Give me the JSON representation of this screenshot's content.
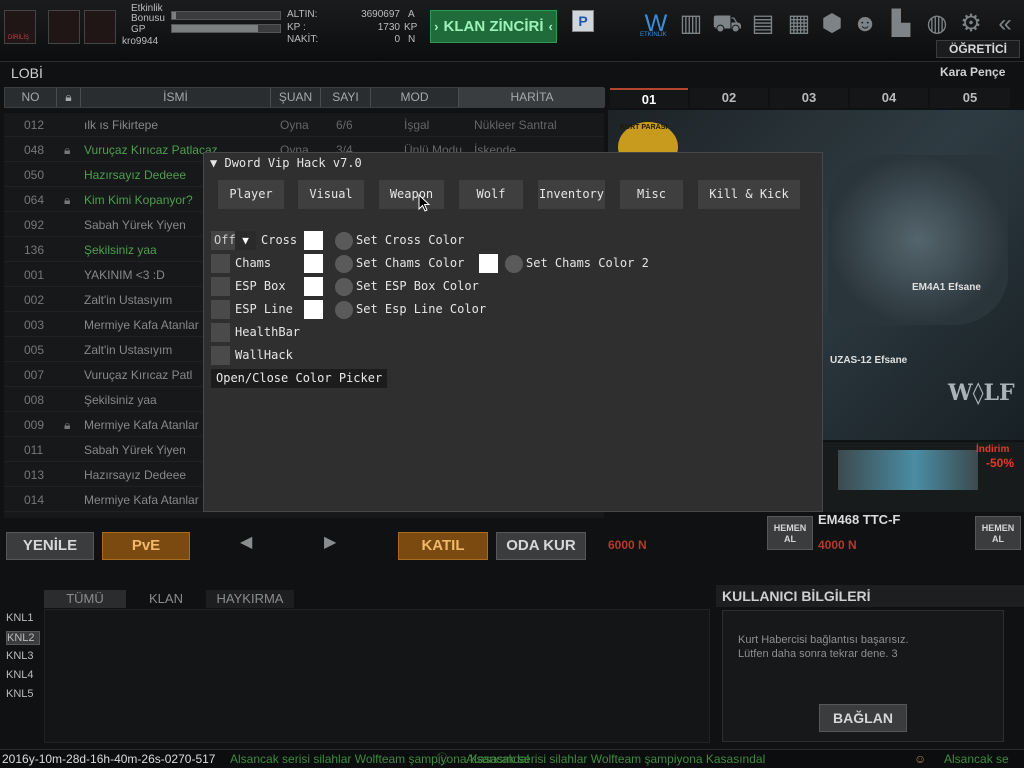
{
  "topbar": {
    "etkinlik": "Etkinlik",
    "bonusu": "Bonusu",
    "gp": "GP",
    "username": "kro9944",
    "altin_label": "ALTIN:",
    "altin_value": "3690697",
    "altin_unit": "A",
    "kp_label": "KP :",
    "kp_value": "1730",
    "kp_unit": "KP",
    "nakit_label": "NAKİT:",
    "nakit_value": "0",
    "nakit_unit": "N",
    "clan_button": "KLAN ZİNCİRİ",
    "ogretici": "ÖĞRETİCİ",
    "etkinlik_icon_label": "ETKİNLİK"
  },
  "lobby": {
    "title": "LOBİ",
    "right_label": "Kara Pençe",
    "headers": [
      "NO",
      "İSMİ",
      "ŞUAN",
      "SAYI",
      "MOD",
      "HARİTA"
    ],
    "rooms": [
      {
        "no": "012",
        "name": "ılk ıs Fikirtepe",
        "state": "Oyna",
        "count": "6/6",
        "mode": "İşgal",
        "map": "Nükleer Santral",
        "locked": false,
        "green": false
      },
      {
        "no": "048",
        "name": "Vuruçaz Kırıcaz Patlacaz",
        "state": "Oyna",
        "count": "3/4",
        "mode": "Ünlü Modu",
        "map": "İskende",
        "locked": true,
        "green": true
      },
      {
        "no": "050",
        "name": "Hazırsayız Dedeee",
        "state": "",
        "count": "",
        "mode": "",
        "map": "",
        "locked": false,
        "green": true
      },
      {
        "no": "064",
        "name": "Kim Kimi Kopanyor?",
        "state": "",
        "count": "",
        "mode": "",
        "map": "",
        "locked": true,
        "green": true
      },
      {
        "no": "092",
        "name": "Sabah Yürek Yiyen",
        "state": "",
        "count": "",
        "mode": "",
        "map": "",
        "locked": false,
        "green": false
      },
      {
        "no": "136",
        "name": "Şekilsiniz yaa",
        "state": "",
        "count": "",
        "mode": "",
        "map": "",
        "locked": false,
        "green": true
      },
      {
        "no": "001",
        "name": "YAKINIM <3 :D",
        "state": "",
        "count": "",
        "mode": "",
        "map": "",
        "locked": false,
        "green": false
      },
      {
        "no": "002",
        "name": "Zalt'in Ustasıyım",
        "state": "",
        "count": "",
        "mode": "",
        "map": "",
        "locked": false,
        "green": false
      },
      {
        "no": "003",
        "name": "Mermiye Kafa Atanlar",
        "state": "",
        "count": "",
        "mode": "",
        "map": "",
        "locked": false,
        "green": false
      },
      {
        "no": "005",
        "name": "Zalt'in Ustasıyım",
        "state": "",
        "count": "",
        "mode": "",
        "map": "",
        "locked": false,
        "green": false
      },
      {
        "no": "007",
        "name": "Vuruçaz Kırıcaz Patl",
        "state": "",
        "count": "",
        "mode": "",
        "map": "",
        "locked": false,
        "green": false
      },
      {
        "no": "008",
        "name": "Şekilsiniz yaa",
        "state": "",
        "count": "",
        "mode": "",
        "map": "",
        "locked": false,
        "green": false
      },
      {
        "no": "009",
        "name": "Mermiye Kafa Atanlar",
        "state": "",
        "count": "",
        "mode": "",
        "map": "",
        "locked": true,
        "green": false
      },
      {
        "no": "011",
        "name": "Sabah Yürek Yiyen",
        "state": "",
        "count": "",
        "mode": "",
        "map": "",
        "locked": false,
        "green": false
      },
      {
        "no": "013",
        "name": "Hazırsayız Dedeee",
        "state": "",
        "count": "",
        "mode": "",
        "map": "",
        "locked": false,
        "green": false
      },
      {
        "no": "014",
        "name": "Mermiye Kafa Atanlar",
        "state": "",
        "count": "",
        "mode": "",
        "map": "",
        "locked": false,
        "green": false
      }
    ],
    "yenile": "YENİLE",
    "pve": "PvE",
    "katil": "KATIL",
    "oda_kur": "ODA KUR"
  },
  "right_panel": {
    "slots": [
      "01",
      "02",
      "03",
      "04",
      "05"
    ],
    "kurt_parasi": "KURT PARASI",
    "weapon1": "EM4A1 Efsane",
    "weapon2": "UZAS-12 Efsane",
    "indirim": "İndirim",
    "discount": "-50%",
    "item_name": "EM468 TTC-F",
    "price_old": "6000 N",
    "price_new": "4000 N",
    "buy_label_1": "HEMEN",
    "buy_label_2": "AL"
  },
  "chat": {
    "tabs": [
      "TÜMÜ",
      "KLAN",
      "HAYKIRMA"
    ],
    "channels": [
      "KNL1",
      "KNL2",
      "KNL3",
      "KNL4",
      "KNL5"
    ]
  },
  "user_info": {
    "title": "KULLANICI BİLGİLERİ",
    "message_line1": "Kurt Habercisi bağlantısı başarısız.",
    "message_line2": "Lütfen daha sonra tekrar dene. 3",
    "connect": "BAĞLAN"
  },
  "status": {
    "timestamp": "2016y-10m-28d-16h-40m-26s-0270-517",
    "ticker_left": "Alsancak serisi silahlar Wolfteam şampiyona Kasasındal",
    "ticker_mid": "Alsancak serisi silahlar Wolfteam şampiyona Kasasındal",
    "ticker_right": "Alsancak se"
  },
  "overlay": {
    "title": "Dword Vip Hack v7.0",
    "tabs": [
      "Player",
      "Visual",
      "Weapon",
      "Wolf",
      "Inventory",
      "Misc",
      "Kill & Kick"
    ],
    "cross_state": "Off",
    "cross_label": "Cross",
    "set_cross_color": "Set Cross Color",
    "chams_label": "Chams",
    "set_chams_color": "Set Chams Color",
    "set_chams_color2": "Set Chams Color 2",
    "esp_box_label": "ESP Box",
    "set_esp_box_color": "Set ESP Box Color",
    "esp_line_label": "ESP Line",
    "set_esp_line_color": "Set Esp Line Color",
    "healthbar_label": "HealthBar",
    "wallhack_label": "WallHack",
    "picker_button": "Open/Close Color Picker"
  },
  "colors": {
    "accent_green": "#1f6b3a",
    "accent_orange": "#a86b1f",
    "price_red": "#b53a2a",
    "discount_red": "#e23a2a"
  }
}
